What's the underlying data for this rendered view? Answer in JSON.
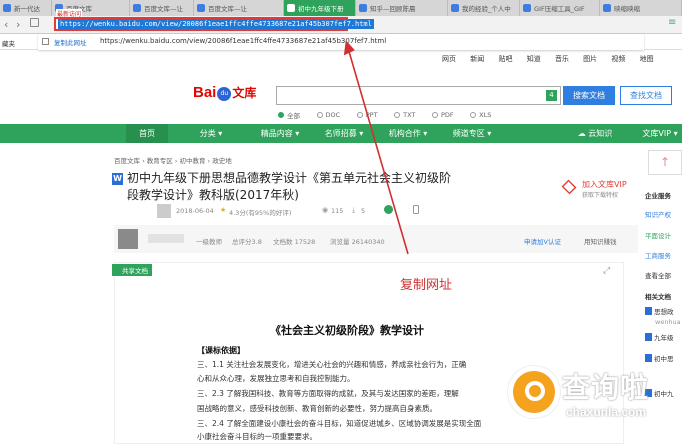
{
  "browser": {
    "tabs": [
      {
        "label": "新一代达"
      },
      {
        "label": "百度文库"
      },
      {
        "label": "百度文库—让"
      },
      {
        "label": "百度文库—让"
      },
      {
        "label": "初中九年级下册"
      },
      {
        "label": "知乎—回顾陈晨"
      },
      {
        "label": "我的经验_个人中"
      },
      {
        "label": "GIF压缩工具_GIF"
      },
      {
        "label": "映缩映缩"
      }
    ],
    "url": "https://wenku.baidu.com/view/20086f1eae1ffc4ffe4733687e21af45b307fef7.html",
    "suggest_copy_label": "复制此网址",
    "suggest_url": "https://wenku.baidu.com/view/20086f1eae1ffc4ffe4733687e21af45b307fef7.html",
    "bookmarks_label": "藏夹",
    "history_tag": "最新访问"
  },
  "topnav": [
    "网页",
    "新闻",
    "贴吧",
    "知道",
    "音乐",
    "图片",
    "视频",
    "地图"
  ],
  "logo": {
    "bai": "Bai",
    "du": "du",
    "wenku": "文库"
  },
  "search": {
    "count": "4",
    "search_btn": "搜索文档",
    "view_btn": "查找文档",
    "filters": [
      "全部",
      "DOC",
      "PPT",
      "TXT",
      "PDF",
      "XLS"
    ]
  },
  "menu": {
    "items": [
      "首页",
      "分类",
      "精品内容",
      "名师招募",
      "机构合作",
      "频道专区"
    ],
    "right": [
      "云知识",
      "文库VIP"
    ]
  },
  "breadcrumb": "百度文库 › 教育专区 › 初中教育 › 政史地",
  "doc": {
    "title_line1": "初中九年级下册思想品德教学设计《第五单元社会主义初级阶",
    "title_line2": "段教学设计》教科版(2017年秋)",
    "date": "2018-06-04",
    "rating": "4.3分(有95%的好评)",
    "views": "115",
    "downloads": "5",
    "vip_label": "加入文库VIP",
    "vip_sub": "获取下载特权",
    "author_level": "一级教师",
    "author_score": "总评分3.8",
    "author_docs": "文档数 17528",
    "author_views": "浏览量 26140340",
    "certify": "申请加V认证",
    "more": "用知识赚钱",
    "share_tag": "共享文档",
    "heading": "《社会主义初级阶段》教学设计",
    "section": "【课标依据】",
    "lines": [
      "三、1.1 关注社会发展变化，增进关心社会的兴趣和情感，养成亲社会行为，正确",
      "心和从众心理，发展独立思考和自我控制能力。",
      "三、2.3 了解我国科技、教育等方面取得的成就，及其与发达国家的差距，理解",
      "国战略的意义，感受科技创新、教育创新的必要性，努力提高自身素质。",
      "三、2.4 了解全面建设小康社会的奋斗目标，知道促进城乡、区域协调发展是实现全面",
      "小康社会奋斗目标的一项重要要求。"
    ]
  },
  "side": {
    "service_title": "企业服务",
    "links": [
      "知识产权",
      "平面设计",
      "工商服务",
      "查看全部"
    ],
    "related_title": "相关文档",
    "related": [
      "思想政",
      "wenhua",
      "九年级",
      "初中思",
      "初中九"
    ]
  },
  "annotation": "复制网址",
  "watermark": {
    "title": "查询啦",
    "url": "chaxunla.com"
  }
}
